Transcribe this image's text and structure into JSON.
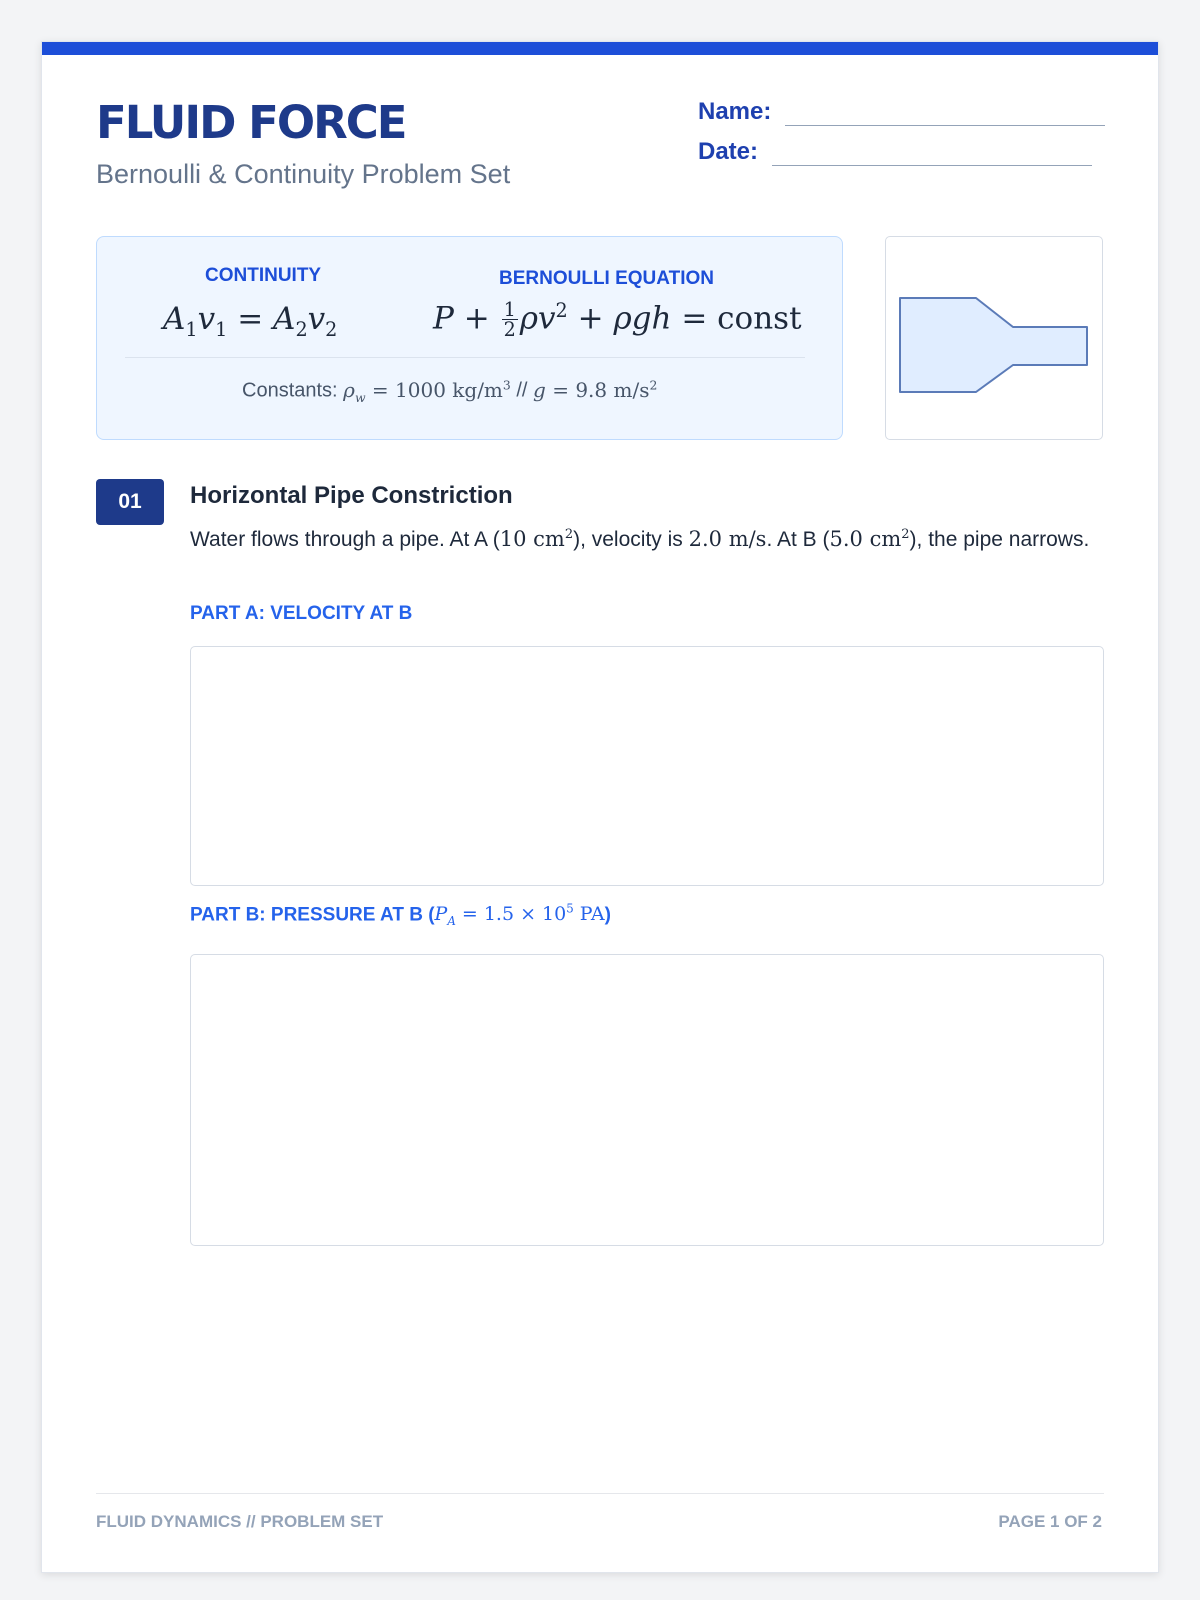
{
  "header": {
    "title": "FLUID FORCE",
    "subtitle": "Bernoulli & Continuity Problem Set",
    "name_label": "Name:",
    "date_label": "Date:"
  },
  "reference": {
    "continuity_heading": "CONTINUITY",
    "bernoulli_heading": "BERNOULLI EQUATION",
    "continuity_equation": "A₁v₁ = A₂v₂",
    "bernoulli_equation": "P + ½ρv² + ρgh = const",
    "constants_label": "Constants:",
    "constants_water": "ρw = 1000 kg/m³",
    "constants_separator": "//",
    "constants_gravity": "g = 9.8 m/s²"
  },
  "diagram": {
    "icon": "pipe-constriction-icon",
    "fill": "#e0edff",
    "stroke": "#5b7bb8"
  },
  "problem": {
    "number": "01",
    "title": "Horizontal Pipe Constriction",
    "text_1": "Water flows through a pipe. At A (",
    "area_a": "10 cm²",
    "text_2": "), velocity is ",
    "velocity_a": "2.0 m/s",
    "text_3": ". At B (",
    "area_b": "5.0 cm²",
    "text_4": "), the pipe narrows.",
    "part_a_label": "PART A: VELOCITY AT B",
    "part_b_label": "PART B: PRESSURE AT B (",
    "part_b_value": "PA = 1.5 × 10⁵ PA",
    "part_b_close": ")"
  },
  "footer": {
    "left": "FLUID DYNAMICS // PROBLEM SET",
    "right": "PAGE 1 OF 2"
  },
  "colors": {
    "accent": "#1d4ed8",
    "heading": "#1e3a8a",
    "part_label": "#2563eb"
  }
}
